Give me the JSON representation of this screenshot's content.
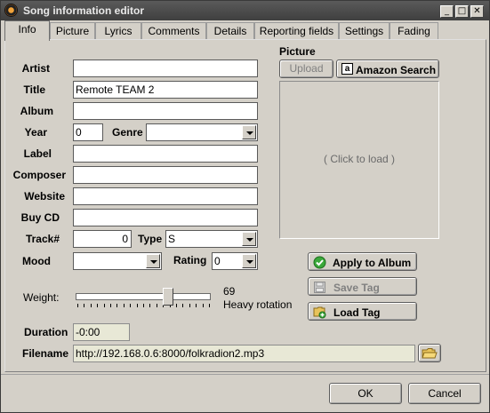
{
  "window": {
    "title": "Song information editor",
    "controls": [
      "_",
      "□",
      "✕"
    ]
  },
  "tabs": [
    "Info",
    "Picture",
    "Lyrics",
    "Comments",
    "Details",
    "Reporting fields",
    "Settings",
    "Fading"
  ],
  "active_tab": "Info",
  "form": {
    "artist": {
      "label": "Artist",
      "value": ""
    },
    "title": {
      "label": "Title",
      "value": "Remote TEAM 2"
    },
    "album": {
      "label": "Album",
      "value": ""
    },
    "year": {
      "label": "Year",
      "value": "0"
    },
    "genre": {
      "label": "Genre",
      "value": ""
    },
    "label": {
      "label": "Label",
      "value": ""
    },
    "composer": {
      "label": "Composer",
      "value": ""
    },
    "website": {
      "label": "Website",
      "value": ""
    },
    "buy_cd": {
      "label": "Buy CD",
      "value": ""
    },
    "track": {
      "label": "Track#",
      "value": "0"
    },
    "type": {
      "label": "Type",
      "value": "S"
    },
    "mood": {
      "label": "Mood",
      "value": ""
    },
    "rating": {
      "label": "Rating",
      "value": "0"
    },
    "weight": {
      "label": "Weight:",
      "value": "69",
      "description": "Heavy rotation",
      "max": 100,
      "fraction": 0.69
    },
    "duration": {
      "label": "Duration",
      "value": "-0:00"
    },
    "filename": {
      "label": "Filename",
      "value": "http://192.168.0.6:8000/folkradion2.mp3"
    }
  },
  "picture": {
    "heading": "Picture",
    "upload_label": "Upload",
    "amazon_label": "Amazon Search",
    "placeholder": "( Click to load )"
  },
  "actions": {
    "apply_album": "Apply to Album",
    "save_tag": "Save Tag",
    "load_tag": "Load Tag"
  },
  "footer": {
    "ok": "OK",
    "cancel": "Cancel"
  },
  "colors": {
    "titlebar": "#4a4a4a",
    "dialog_bg": "#d4d0c8",
    "readonly_field": "#e8e8d6",
    "apply_icon": "#3aa83a"
  }
}
